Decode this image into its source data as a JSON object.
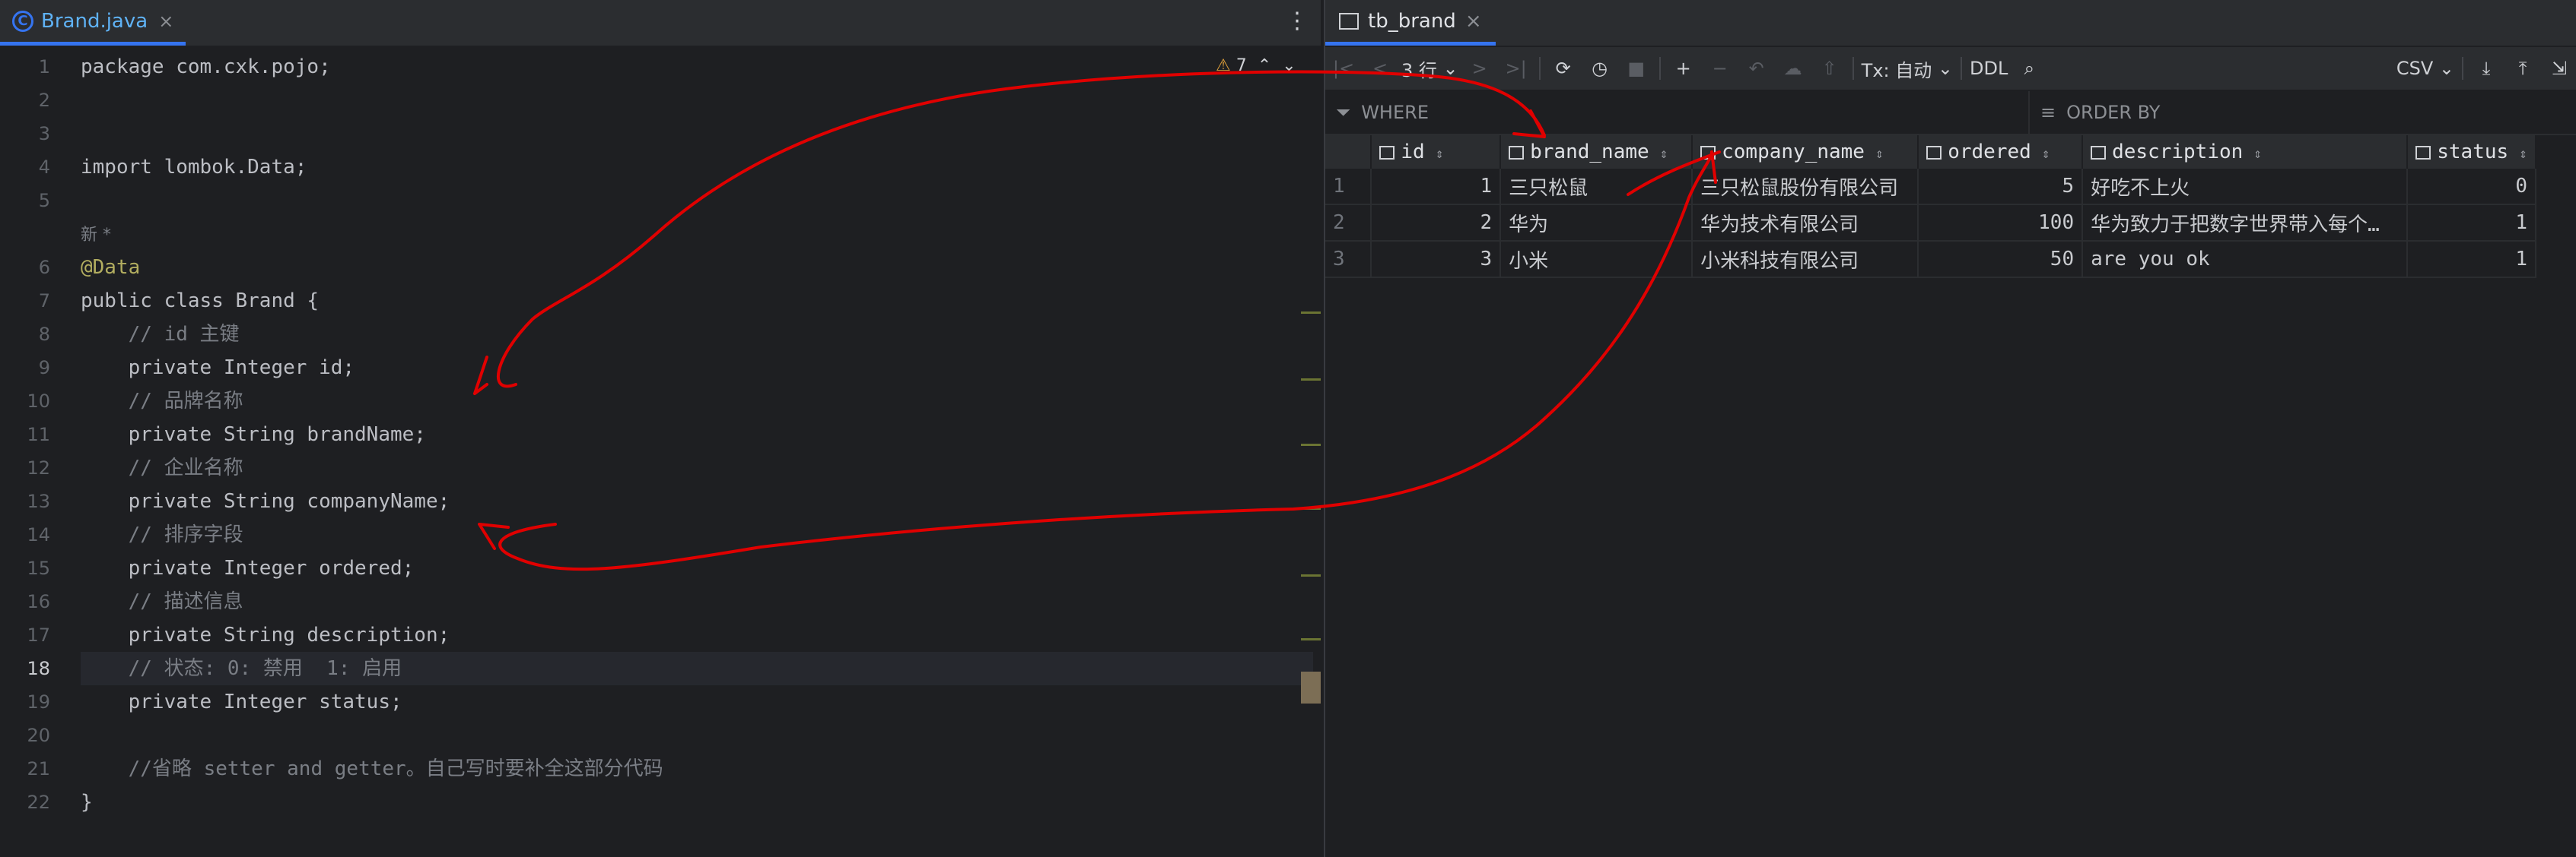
{
  "editor": {
    "tab_name": "Brand.java",
    "tab_icon": "C",
    "warnings": "7",
    "inlay_hint": "新 *",
    "lines": [
      {
        "no": "1",
        "text": "package com.cxk.pojo;"
      },
      {
        "no": "2",
        "text": ""
      },
      {
        "no": "3",
        "text": ""
      },
      {
        "no": "4",
        "text": "import lombok.Data;"
      },
      {
        "no": "5",
        "text": ""
      },
      {
        "no": "6",
        "text": "@Data"
      },
      {
        "no": "7",
        "text": "public class Brand {"
      },
      {
        "no": "8",
        "text": "    // id 主键"
      },
      {
        "no": "9",
        "text": "    private Integer id;"
      },
      {
        "no": "10",
        "text": "    // 品牌名称"
      },
      {
        "no": "11",
        "text": "    private String brandName;"
      },
      {
        "no": "12",
        "text": "    // 企业名称"
      },
      {
        "no": "13",
        "text": "    private String companyName;"
      },
      {
        "no": "14",
        "text": "    // 排序字段"
      },
      {
        "no": "15",
        "text": "    private Integer ordered;"
      },
      {
        "no": "16",
        "text": "    // 描述信息"
      },
      {
        "no": "17",
        "text": "    private String description;"
      },
      {
        "no": "18",
        "text": "    // 状态: 0: 禁用  1: 启用"
      },
      {
        "no": "19",
        "text": "    private Integer status;"
      },
      {
        "no": "20",
        "text": ""
      },
      {
        "no": "21",
        "text": "    //省略 setter and getter。自己写时要补全这部分代码"
      },
      {
        "no": "22",
        "text": "}"
      }
    ]
  },
  "db": {
    "tab_name": "tb_brand",
    "toolbar": {
      "rows_label": "3 行",
      "tx_label": "Tx: 自动",
      "ddl_label": "DDL",
      "export_label": "CSV"
    },
    "filter": {
      "where_placeholder": "WHERE",
      "orderby_placeholder": "ORDER BY"
    },
    "columns": [
      "id",
      "brand_name",
      "company_name",
      "ordered",
      "description",
      "status"
    ],
    "rows": [
      {
        "rn": "1",
        "id": "1",
        "brand_name": "三只松鼠",
        "company_name": "三只松鼠股份有限公司",
        "ordered": "5",
        "description": "好吃不上火",
        "status": "0"
      },
      {
        "rn": "2",
        "id": "2",
        "brand_name": "华为",
        "company_name": "华为技术有限公司",
        "ordered": "100",
        "description": "华为致力于把数字世界带入每个…",
        "status": "1"
      },
      {
        "rn": "3",
        "id": "3",
        "brand_name": "小米",
        "company_name": "小米科技有限公司",
        "ordered": "50",
        "description": "are you ok",
        "status": "1"
      }
    ]
  },
  "colors": {
    "annotation_arrows": "#e00000",
    "keyword": "#cf8e6d",
    "field": "#c77dbb",
    "accent": "#3574f0"
  }
}
